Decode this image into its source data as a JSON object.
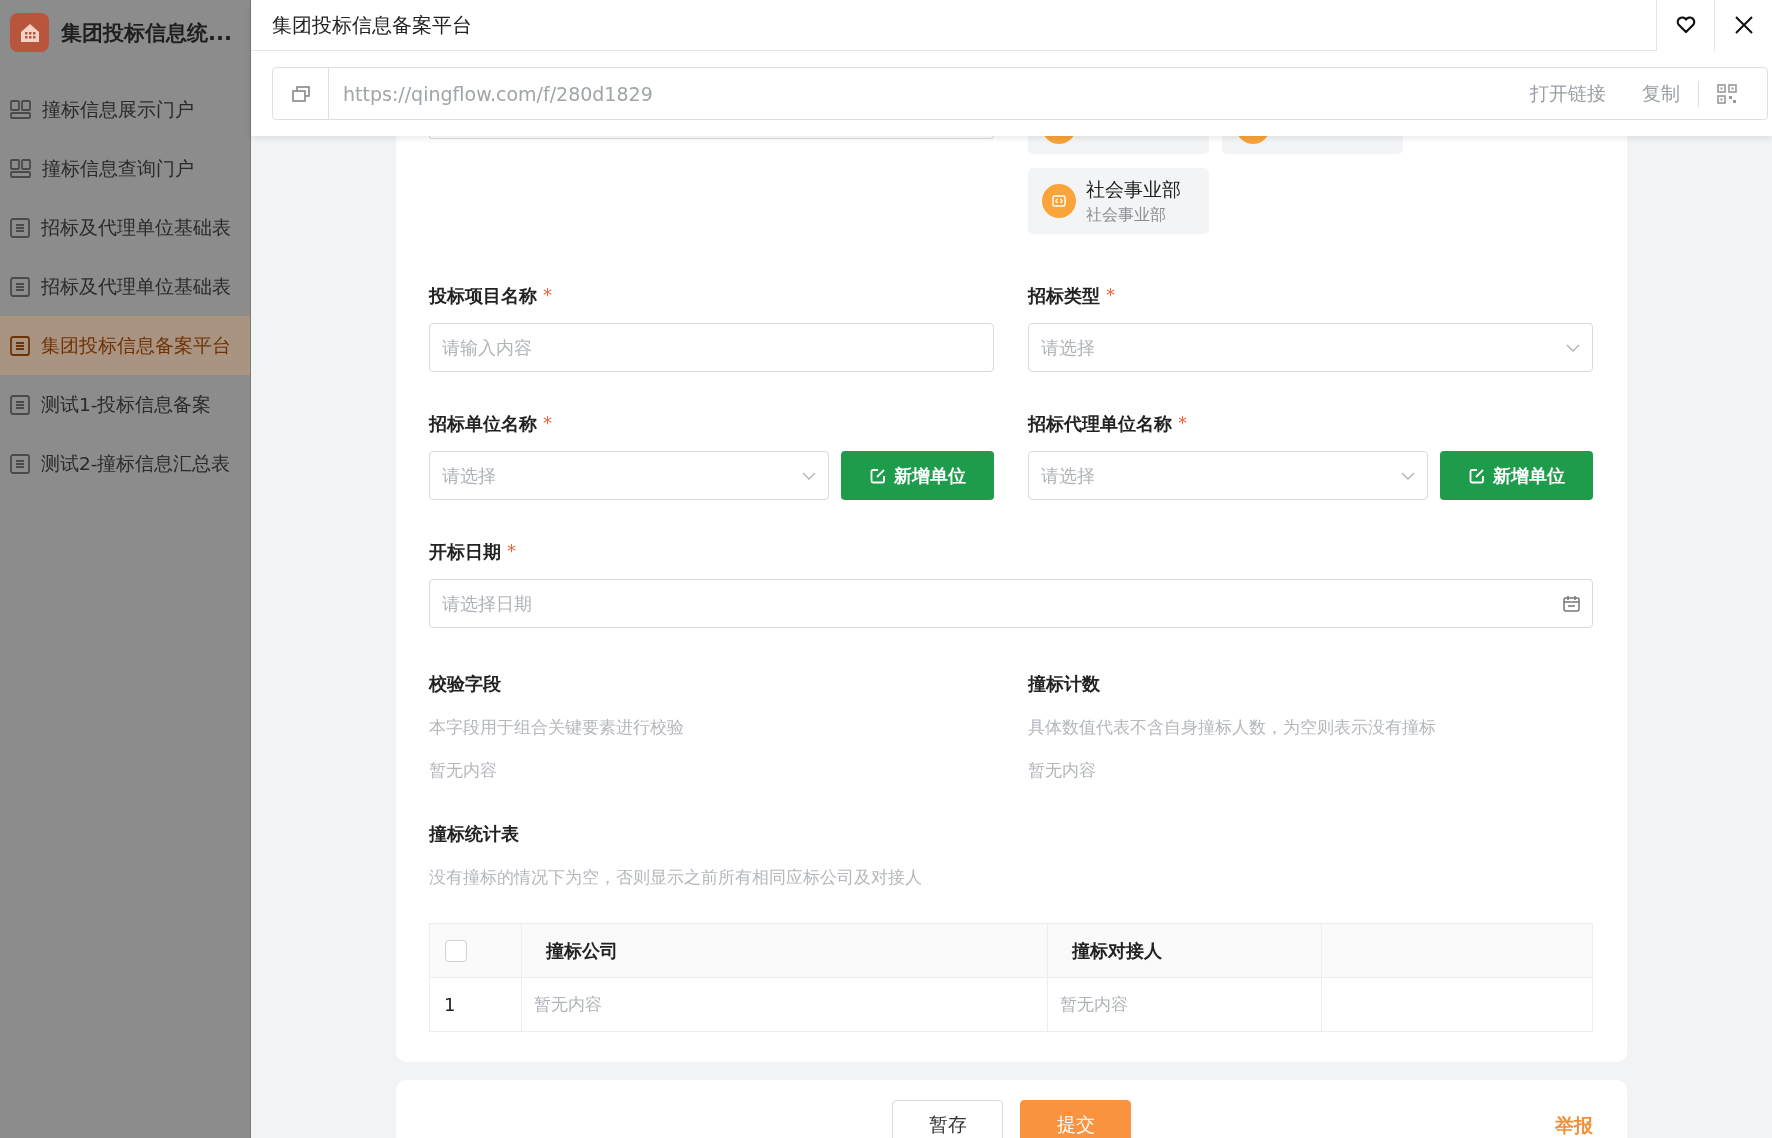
{
  "sidebar": {
    "app_title": "集团投标信息统...",
    "items": [
      {
        "label": "撞标信息展示门户",
        "kind": "portal",
        "selected": false
      },
      {
        "label": "撞标信息查询门户",
        "kind": "portal",
        "selected": false
      },
      {
        "label": "招标及代理单位基础表",
        "kind": "form",
        "selected": false
      },
      {
        "label": "招标及代理单位基础表",
        "kind": "form",
        "selected": false
      },
      {
        "label": "集团投标信息备案平台",
        "kind": "form",
        "selected": true
      },
      {
        "label": "测试1-投标信息备案",
        "kind": "form",
        "selected": false
      },
      {
        "label": "测试2-撞标信息汇总表",
        "kind": "form",
        "selected": false
      }
    ]
  },
  "header": {
    "title": "集团投标信息备案平台"
  },
  "link_bar": {
    "url": "https://qingflow.com/f/280d1829",
    "actions": [
      "打开链接",
      "复制"
    ]
  },
  "member_cards": [
    {
      "kind": "clipped"
    },
    {
      "kind": "clipped"
    },
    {
      "kind": "full",
      "name": "社会事业部",
      "subtitle": "社会事业部"
    }
  ],
  "field_rows": [
    [
      {
        "kind": "text",
        "label": "投标项目名称",
        "required_mark": "*",
        "placeholder": "请输入内容"
      },
      {
        "kind": "select",
        "label": "招标类型",
        "required_mark": "*",
        "placeholder": "请选择"
      }
    ],
    [
      {
        "kind": "select_add",
        "label": "招标单位名称",
        "required_mark": "*",
        "placeholder": "请选择",
        "button_label": "新增单位"
      },
      {
        "kind": "select_add",
        "label": "招标代理单位名称",
        "required_mark": "*",
        "placeholder": "请选择",
        "button_label": "新增单位"
      }
    ],
    [
      {
        "kind": "date",
        "label": "开标日期",
        "required_mark": "*",
        "placeholder": "请选择日期"
      }
    ]
  ],
  "info_fields": [
    {
      "label": "校验字段",
      "description": "本字段用于组合关键要素进行校验",
      "value": "暂无内容"
    },
    {
      "label": "撞标计数",
      "description": "具体数值代表不含自身撞标人数，为空则表示没有撞标",
      "value": "暂无内容"
    }
  ],
  "subtable": {
    "label": "撞标统计表",
    "description": "没有撞标的情况下为空，否则显示之前所有相同应标公司及对接人",
    "select_all": {
      "checked": false
    },
    "columns": [
      "撞标公司",
      "撞标对接人"
    ],
    "rows": [
      {
        "index": "1",
        "cells": [
          "暂无内容",
          "暂无内容"
        ]
      }
    ]
  },
  "footer": {
    "buttons": [
      {
        "label": "暂存",
        "kind": "secondary"
      },
      {
        "label": "提交",
        "kind": "primary"
      }
    ],
    "report_link": "举报"
  }
}
